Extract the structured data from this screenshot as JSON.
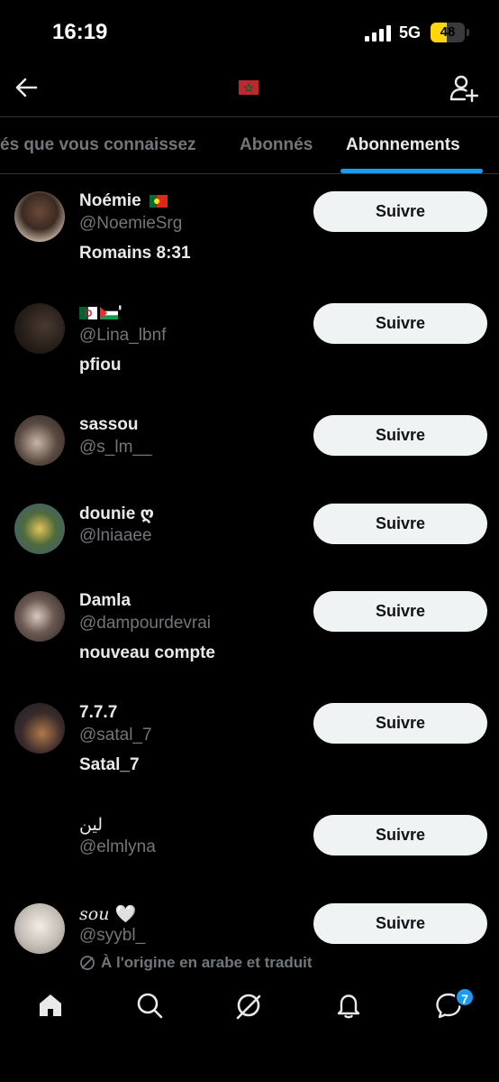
{
  "status_bar": {
    "time": "16:19",
    "network": "5G",
    "battery": "48",
    "battery_level": 0.48
  },
  "header": {
    "title_icon": "morocco-flag-icon",
    "back_icon": "back-arrow-icon",
    "action_icon": "add-user-icon"
  },
  "tabs": [
    {
      "label": "és que vous connaissez",
      "active": false
    },
    {
      "label": "Abonnés",
      "active": false
    },
    {
      "label": "Abonnements",
      "active": true
    }
  ],
  "accent_color": "#1d9bf0",
  "users": [
    {
      "name": "Noémie",
      "handle": "@NoemieSrg",
      "bio": "Romains 8:31",
      "follow_label": "Suivre"
    },
    {
      "name": "'",
      "handle": "@Lina_lbnf",
      "bio": "pfiou",
      "follow_label": "Suivre"
    },
    {
      "name": "sassou",
      "handle": "@s_lm__",
      "bio": "",
      "follow_label": "Suivre"
    },
    {
      "name": "dounie ღ",
      "handle": "@lniaaee",
      "bio": "",
      "follow_label": "Suivre"
    },
    {
      "name": "Damla",
      "handle": "@dampourdevrai",
      "bio": "nouveau compte",
      "follow_label": "Suivre"
    },
    {
      "name": "7.7.7",
      "handle": "@satal_7",
      "bio": "Satal_7",
      "follow_label": "Suivre"
    },
    {
      "name": "ﻟﻴﻦ",
      "handle": "@elmlyna",
      "bio": "",
      "follow_label": "Suivre"
    },
    {
      "name": "𝑠𝑜𝑢 🤍",
      "handle": "@syybl_",
      "bio": "",
      "translated_note": "À l'origine en arabe et traduit",
      "follow_label": "Suivre"
    }
  ],
  "bottom_nav": {
    "items": [
      "home-icon",
      "search-icon",
      "grok-icon",
      "notifications-icon",
      "messages-icon"
    ],
    "messages_badge": "7"
  }
}
